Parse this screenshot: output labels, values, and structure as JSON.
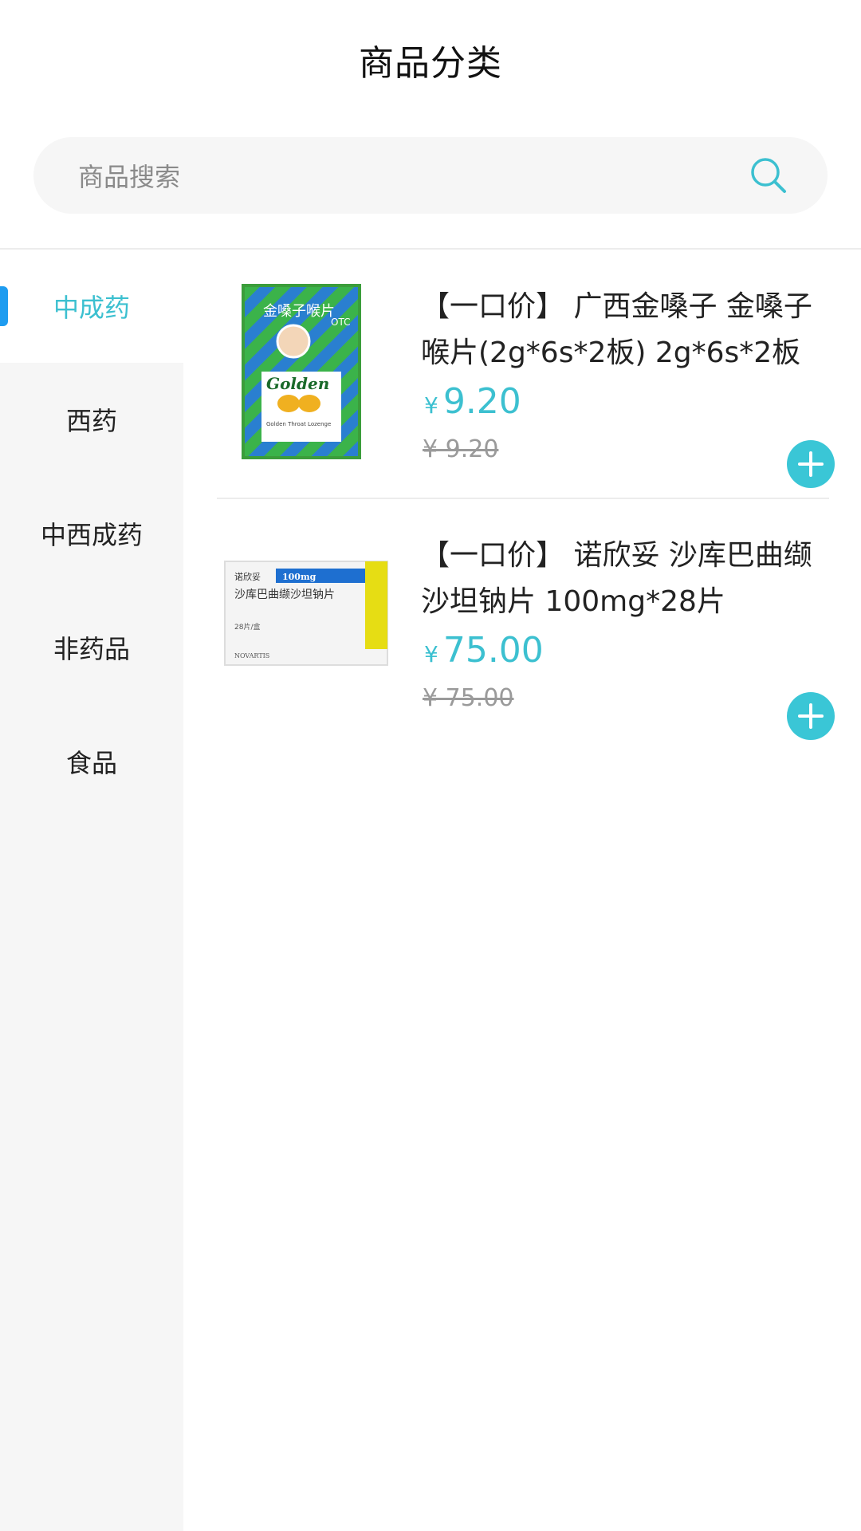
{
  "header": {
    "title": "商品分类"
  },
  "search": {
    "placeholder": "商品搜索",
    "icon": "search-icon"
  },
  "sidebar": {
    "items": [
      {
        "label": "中成药",
        "active": true
      },
      {
        "label": "西药",
        "active": false
      },
      {
        "label": "中西成药",
        "active": false
      },
      {
        "label": "非药品",
        "active": false
      },
      {
        "label": "食品",
        "active": false
      }
    ]
  },
  "products": [
    {
      "title": "【一口价】 广西金嗓子 金嗓子喉片(2g*6s*2板) 2g*6s*2板",
      "currency": "¥",
      "price": "9.20",
      "original_price": "¥ 9.20",
      "image_text": {
        "brand": "Golden",
        "badge": "OTC",
        "cn_name": "金嗓子喉片",
        "sub": "Golden Throat Lozenge"
      }
    },
    {
      "title": "【一口价】 诺欣妥 沙库巴曲缬沙坦钠片 100mg*28片",
      "currency": "¥",
      "price": "75.00",
      "original_price": "¥ 75.00",
      "image_text": {
        "brand": "诺欣妥",
        "dose": "100mg",
        "cn_name": "沙库巴曲缬沙坦钠片",
        "count": "28片/盒",
        "maker": "NOVARTIS"
      }
    }
  ],
  "colors": {
    "accent": "#3cc0d0",
    "active_marker": "#1e9cf0",
    "sidebar_bg": "#f6f6f6"
  }
}
